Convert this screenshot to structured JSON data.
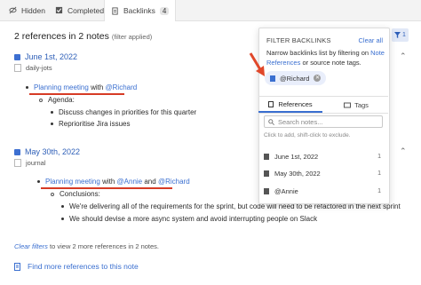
{
  "tabs": [
    {
      "label": "Hidden",
      "icon": "eye-off-icon"
    },
    {
      "label": "Completed",
      "icon": "checkbox-icon"
    },
    {
      "label": "Backlinks",
      "icon": "document-icon",
      "count": "4"
    }
  ],
  "summary": {
    "text": "2 references in 2 notes",
    "filter_note": "(filter applied)"
  },
  "notes": [
    {
      "title": "June 1st, 2022",
      "subtitle": "daily-jots",
      "lines": {
        "l1a": "Planning meeting",
        "l1b": "with",
        "l1c": "@Richard",
        "l2": "Agenda:",
        "l3": "Discuss changes in priorities for this quarter",
        "l4": "Reprioritise Jira issues"
      }
    },
    {
      "title": "May 30th, 2022",
      "subtitle": "journal",
      "lines": {
        "l1a": "Planning meeting",
        "l1b": "with",
        "l1c": "@Annie",
        "l1d": "and",
        "l1e": "@Richard",
        "l2": "Conclusions:",
        "l3": "We're delivering all of the requirements for the sprint, but code will need to be refactored in the next sprint",
        "l4": "We should devise a more async system and avoid interrupting people on Slack"
      }
    }
  ],
  "clear": {
    "link": "Clear filters",
    "rest": "to view 2 more references in 2 notes."
  },
  "more_link": "Find more references to this note",
  "popover": {
    "title": "FILTER BACKLINKS",
    "clear_all": "Clear all",
    "desc_a": "Narrow backlinks list by filtering on",
    "desc_link": "Note References",
    "desc_b": "or source note tags.",
    "chip": "@Richard",
    "tab_refs": "References",
    "tab_tags": "Tags",
    "search_placeholder": "Search notes...",
    "hint": "Click to add, shift-click to exclude.",
    "items": [
      {
        "label": "June 1st, 2022",
        "count": "1"
      },
      {
        "label": "May 30th, 2022",
        "count": "1"
      },
      {
        "label": "@Annie",
        "count": "1"
      }
    ]
  },
  "filter_button_count": "1",
  "colors": {
    "accent": "#3a6fd0",
    "annotation": "#d63b25"
  }
}
